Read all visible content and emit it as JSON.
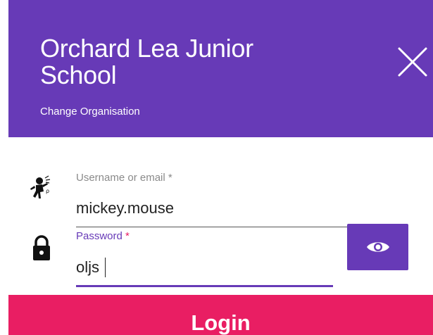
{
  "header": {
    "organisation_name": "Orchard Lea Junior School",
    "change_organisation_link": "Change Organisation"
  },
  "form": {
    "username": {
      "label": "Username or email",
      "required_marker": "*",
      "value": "mickey.mouse",
      "icon": "user-icon"
    },
    "password": {
      "label": "Password",
      "required_marker": "*",
      "value": "oljs",
      "icon": "lock-icon"
    },
    "show_password_icon": "eye-icon",
    "login_button": "Login"
  },
  "colors": {
    "primary": "#673ab7",
    "accent": "#e91e63",
    "text": "#222222",
    "label_muted": "#8a8a8a"
  }
}
